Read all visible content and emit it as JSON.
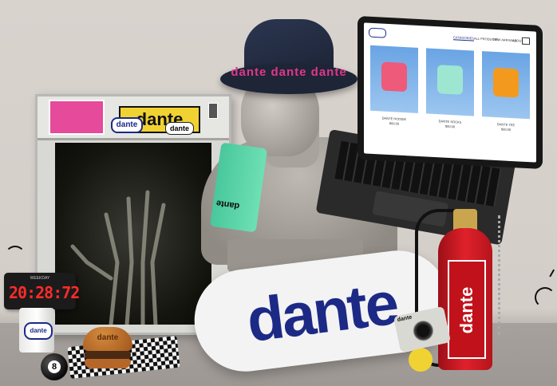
{
  "scene": {
    "lightbox": {
      "sticker_logo": "dante",
      "sticker_small": "dante",
      "sticker_small2": "dante"
    },
    "hat": {
      "text": "dante  dante  dante"
    },
    "towel": {
      "text": "dante"
    },
    "clock": {
      "label": "WEEKDAY",
      "digits": "20:28:72"
    },
    "can": {
      "badge": "dante"
    },
    "ball": {
      "number": "8"
    },
    "burger": {
      "text": "dante"
    },
    "skateboard": {
      "text": "dante"
    },
    "extinguisher": {
      "text": "dante"
    },
    "camera": {
      "text": "dante"
    },
    "laptop": {
      "nav_items": [
        "CATEGORIES",
        "ALL PRODUCTS",
        "NEW ARRIVALS",
        "ABOUT"
      ],
      "products": [
        {
          "caption": "DANTE HOODIE",
          "price": "$00.00",
          "color": "#ee5a7a"
        },
        {
          "caption": "DANTE SOCKS",
          "price": "$00.00",
          "color": "#9ee6d2"
        },
        {
          "caption": "DANTE TEE",
          "price": "$00.00",
          "color": "#f39a1e"
        }
      ]
    }
  }
}
